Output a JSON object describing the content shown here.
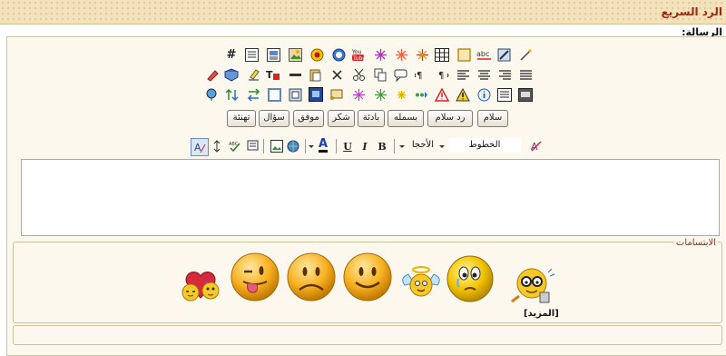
{
  "header": {
    "title": "الرد السريع"
  },
  "form": {
    "message_label": "الرسالة:"
  },
  "quick_buttons": [
    "سلام",
    "رد سلام",
    "بسمله",
    "بادئة",
    "شكر",
    "موفق",
    "سؤال",
    "تهنئة"
  ],
  "format": {
    "font_label": "الخطوط",
    "size_label": "الأحجا",
    "bold": "B",
    "italic": "I",
    "underline": "U",
    "color_letter": "A"
  },
  "smilies": {
    "legend": "الابتسامات",
    "more_label": "[المزيد]"
  },
  "toolbar_icons": {
    "row1": [
      "hash-icon",
      "text-block-icon",
      "image-text-icon",
      "image-icon",
      "flash-icon",
      "info-circle-icon",
      "youtube-icon",
      "firework-purple-icon",
      "firework-red-icon",
      "table-icon",
      "frame-icon",
      "abc-icon",
      "pen-image-icon",
      "wand-icon"
    ],
    "row2": [
      "eraser-icon",
      "book-icon",
      "highlight-icon",
      "text-color-icon",
      "hr-icon",
      "paste-icon",
      "cut-x-icon",
      "scissors-icon",
      "copy-icon",
      "speech-icon",
      "ltr-icon",
      "rtl-icon",
      "align-left-icon",
      "align-center-icon",
      "align-right-icon",
      "justify-icon"
    ],
    "row3": [
      "map-icon",
      "swap-vert-icon",
      "swap-horiz-icon",
      "rect-icon",
      "marquee-icon",
      "film-icon",
      "scroll-icon",
      "sparkle-purple-icon",
      "sparkle-green-icon",
      "sparkle-yellow-icon",
      "arrow-dots-icon",
      "warning-red-icon",
      "warning-yellow-icon",
      "info-icon",
      "list-icon",
      "quote-icon"
    ]
  },
  "colors": {
    "title": "#9b2a10",
    "accent": "#1a3fa8"
  }
}
